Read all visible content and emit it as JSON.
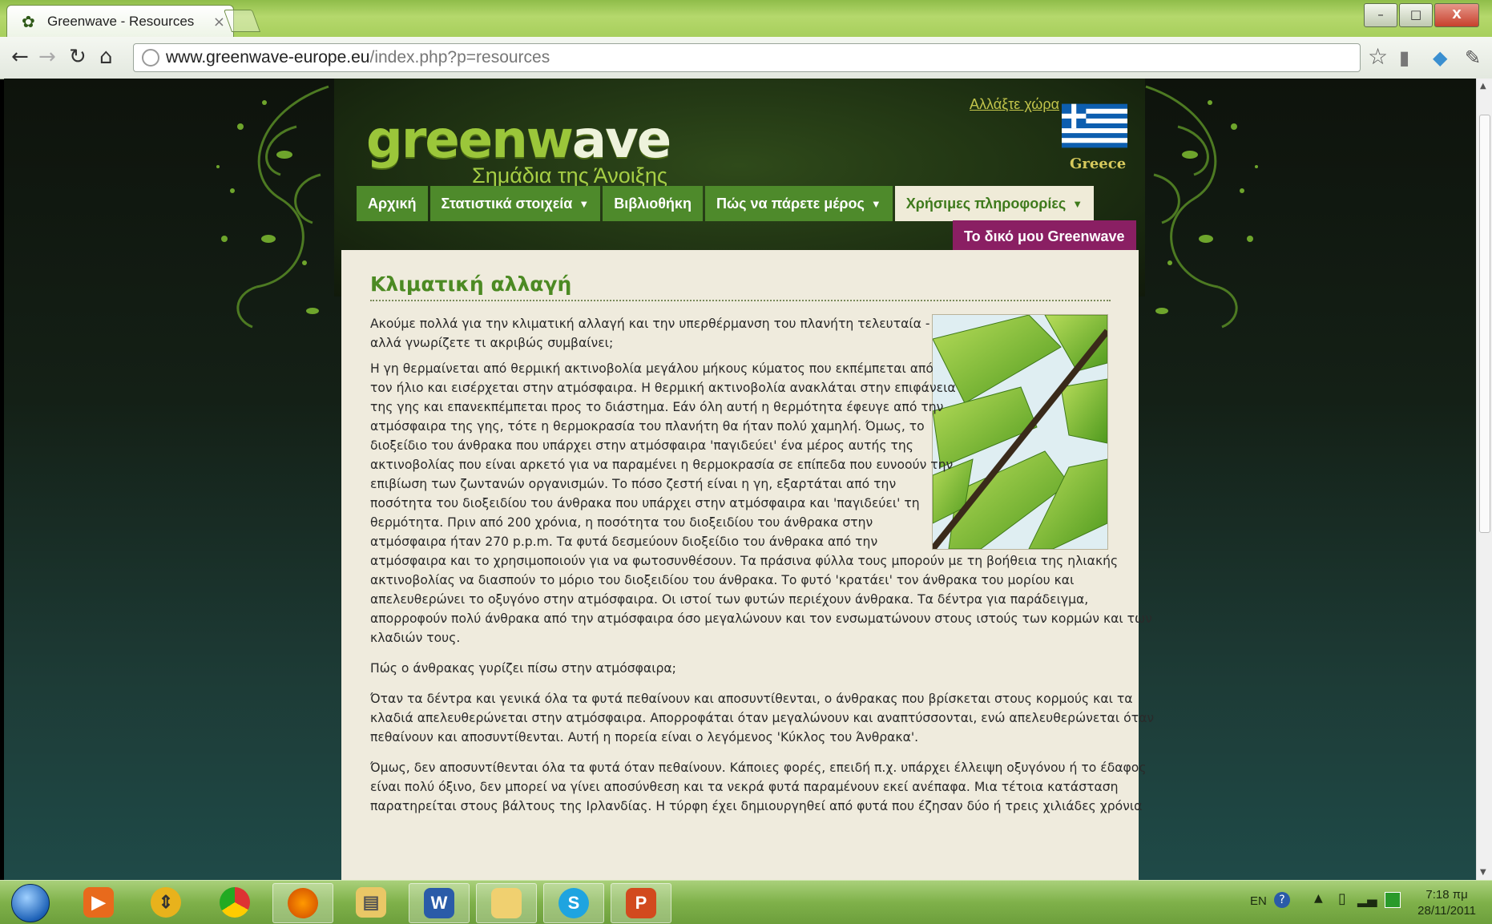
{
  "browser": {
    "tab_title": "Greenwave - Resources",
    "tab_close": "×",
    "url_host": "www.greenwave-europe.eu",
    "url_path": "/index.php?p=resources",
    "window_controls": [
      "–",
      "□",
      "X"
    ]
  },
  "site": {
    "logo_text_a": "greenw",
    "logo_text_b": "ave",
    "logo_subtitle": "Σημάδια της Άνοιξης",
    "change_country": "Αλλάξτε χώρα",
    "country": "Greece",
    "menu": [
      {
        "label": "Αρχική",
        "caret": ""
      },
      {
        "label": "Στατιστικά στοιχεία",
        "caret": "▼"
      },
      {
        "label": "Βιβλιοθήκη",
        "caret": ""
      },
      {
        "label": "Πώς να πάρετε μέρος",
        "caret": "▼"
      },
      {
        "label": "Χρήσιμες πληροφορίες",
        "caret": "▼"
      }
    ],
    "my_greenwave": "Το δικό μου Greenwave"
  },
  "article": {
    "title": "Κλιματική αλλαγή",
    "lines": [
      "Ακούμε πολλά για την κλιματική αλλαγή και την υπερθέρμανση του πλανήτη τελευταία -",
      "αλλά γνωρίζετε τι ακριβώς συμβαίνει;",
      "Η γη θερμαίνεται από θερμική ακτινοβολία μεγάλου μήκους κύματος που εκπέμπεται από",
      "τον ήλιο και εισέρχεται στην ατμόσφαιρα. Η θερμική ακτινοβολία ανακλάται στην επιφάνεια",
      "της γης και επανεκπέμπεται προς το διάστημα. Εάν όλη αυτή η θερμότητα έφευγε από την",
      "ατμόσφαιρα της γης, τότε η θερμοκρασία του πλανήτη θα ήταν πολύ χαμηλή. Όμως, το",
      "διοξείδιο του άνθρακα που υπάρχει στην ατμόσφαιρα 'παγιδεύει' ένα μέρος αυτής της",
      "ακτινοβολίας που είναι αρκετό για να παραμένει η θερμοκρασία σε επίπεδα που ευνοούν την",
      "επιβίωση των ζωντανών οργανισμών. Το πόσο ζεστή είναι η γη, εξαρτάται από την",
      "ποσότητα του διοξειδίου του άνθρακα που υπάρχει στην ατμόσφαιρα και 'παγιδεύει' τη",
      "θερμότητα. Πριν από 200 χρόνια, η ποσότητα του διοξειδίου του άνθρακα στην",
      "ατμόσφαιρα ήταν 270 p.p.m. Τα φυτά δεσμεύουν διοξείδιο του άνθρακα από την",
      "ατμόσφαιρα και το χρησιμοποιούν για να φωτοσυνθέσουν. Τα πράσινα φύλλα τους μπορούν με τη βοήθεια της ηλιακής",
      "ακτινοβολίας να διασπούν το μόριο του διοξειδίου του άνθρακα. Το φυτό 'κρατάει' τον άνθρακα του μορίου και",
      "απελευθερώνει το οξυγόνο στην ατμόσφαιρα. Οι ιστοί των φυτών περιέχουν άνθρακα. Τα δέντρα για παράδειγμα,",
      "απορροφούν πολύ άνθρακα από την ατμόσφαιρα όσο μεγαλώνουν και τον ενσωματώνουν στους ιστούς των κορμών και των",
      "κλαδιών τους.",
      "Πώς ο άνθρακας γυρίζει πίσω στην ατμόσφαιρα;",
      "Όταν τα δέντρα και γενικά όλα τα φυτά πεθαίνουν και αποσυντίθενται, ο άνθρακας που βρίσκεται στους κορμούς και τα",
      "κλαδιά απελευθερώνεται στην ατμόσφαιρα. Απορροφάται όταν μεγαλώνουν και αναπτύσσονται, ενώ απελευθερώνεται όταν",
      "πεθαίνουν και αποσυντίθενται. Αυτή η πορεία είναι ο λεγόμενος 'Κύκλος του Άνθρακα'.",
      "Όμως, δεν αποσυντίθενται όλα τα φυτά όταν πεθαίνουν. Κάποιες φορές, επειδή π.χ. υπάρχει έλλειψη οξυγόνου ή το έδαφος",
      "είναι πολύ όξινο, δεν μπορεί να γίνει αποσύνθεση και τα νεκρά φυτά παραμένουν εκεί ανέπαφα. Μια τέτοια κατάσταση",
      "παρατηρείται στους βάλτους της Ιρλανδίας. Η τύρφη έχει δημιουργηθεί από φυτά που έζησαν δύο ή τρεις χιλιάδες χρόνια"
    ]
  },
  "taskbar": {
    "language": "EN",
    "time": "7:18 πμ",
    "date": "28/11/2011"
  },
  "colors": {
    "menu_green": "#4e8a2b",
    "title_green": "#4c8a23",
    "my_greenwave_bg": "#8a1f63",
    "content_bg": "#efebdd"
  }
}
